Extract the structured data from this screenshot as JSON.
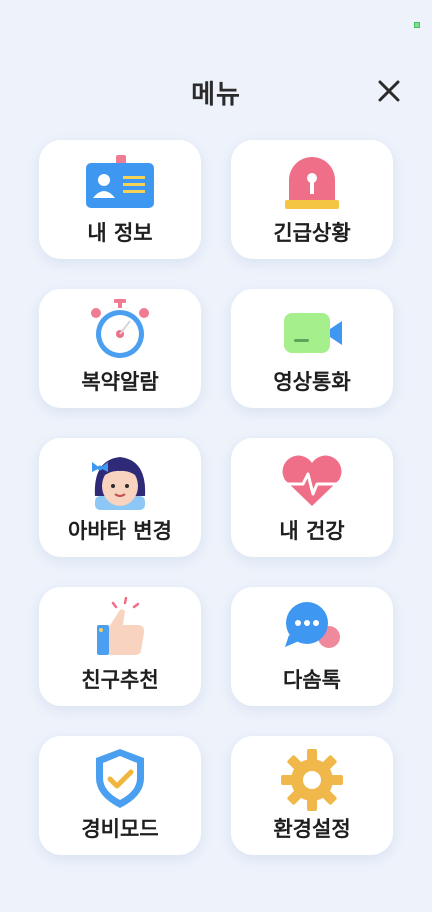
{
  "header": {
    "title": "메뉴"
  },
  "colors": {
    "background": "#eef3fb",
    "card": "#ffffff",
    "text": "#1f1f1f"
  },
  "menu": [
    {
      "label": "내 정보",
      "icon": "id-card-icon"
    },
    {
      "label": "긴급상황",
      "icon": "siren-icon"
    },
    {
      "label": "복약알람",
      "icon": "stopwatch-icon"
    },
    {
      "label": "영상통화",
      "icon": "video-camera-icon"
    },
    {
      "label": "아바타 변경",
      "icon": "avatar-icon"
    },
    {
      "label": "내 건강",
      "icon": "heartbeat-icon"
    },
    {
      "label": "친구추천",
      "icon": "thumbs-up-icon"
    },
    {
      "label": "다솜톡",
      "icon": "chat-bubble-icon"
    },
    {
      "label": "경비모드",
      "icon": "shield-check-icon"
    },
    {
      "label": "환경설정",
      "icon": "gear-icon"
    }
  ]
}
